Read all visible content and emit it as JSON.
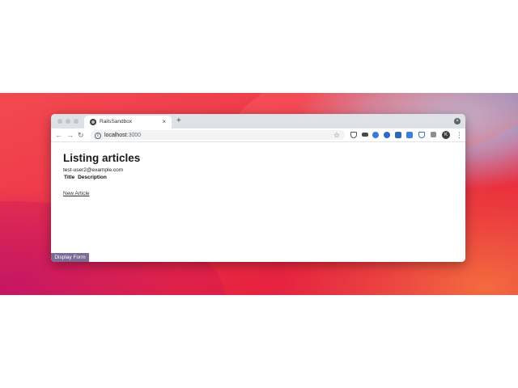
{
  "browser": {
    "tab_title": "RailsSandbox",
    "tab_close": "×",
    "new_tab": "+",
    "window_close": "×",
    "back": "←",
    "forward": "→",
    "reload": "↻",
    "url_host": "localhost",
    "url_port": ":3000",
    "info_icon": "i",
    "star": "☆",
    "profile_initial": "K",
    "menu": "⋮",
    "extensions": [
      "pocket-icon",
      "dashlane-icon",
      "chrome-icon",
      "edge-icon",
      "screen-capture-icon",
      "translate-icon",
      "shield-icon",
      "puzzle-icon"
    ]
  },
  "page": {
    "title": "Listing articles",
    "user_email": "test-user2@example.com",
    "table_headers": [
      "Title",
      "Description"
    ],
    "new_article_link": "New Article",
    "display_form_button": "Display Form"
  },
  "colors": {
    "display_form_bg": "#7c6b97",
    "wallpaper_red": "#ee3348"
  }
}
